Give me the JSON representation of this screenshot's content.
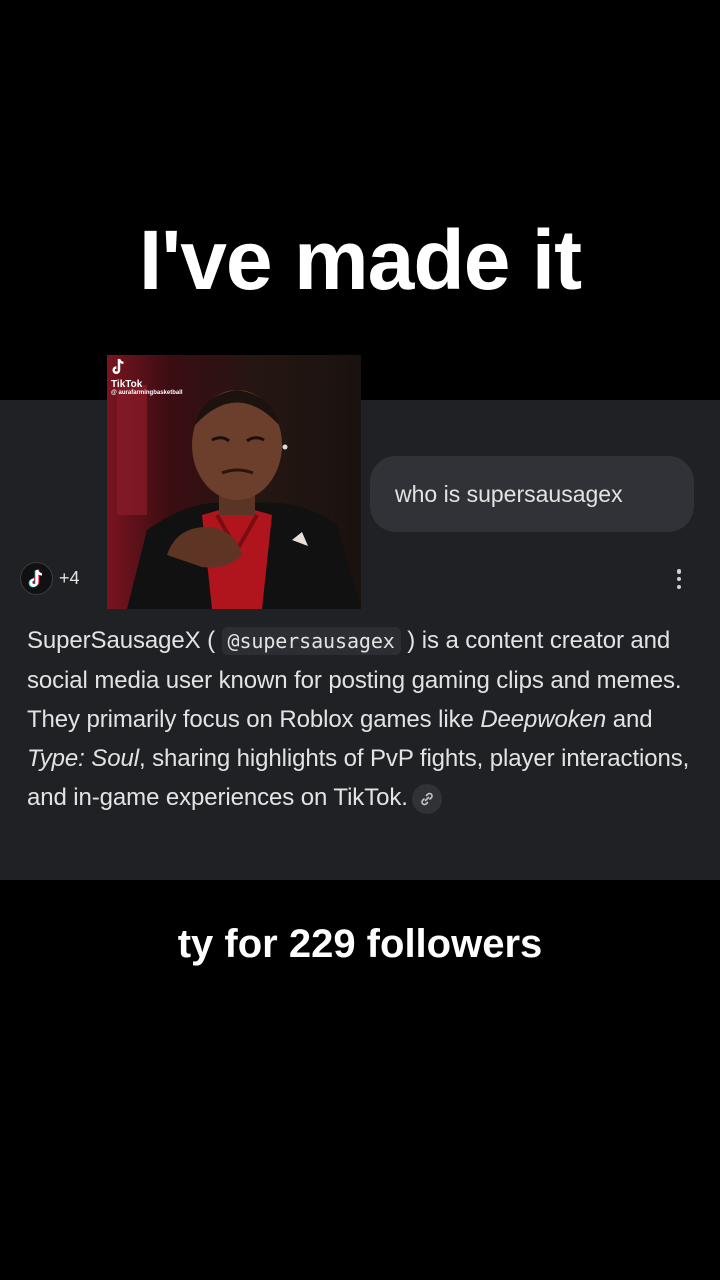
{
  "overlay": {
    "headline": "I've made it",
    "caption": "ty for 229 followers"
  },
  "chat": {
    "user_query": "who is supersausagex",
    "sources": {
      "count_label": "+4",
      "icon": "tiktok-icon"
    },
    "answer": {
      "name": "SuperSausageX",
      "open_paren": " ( ",
      "handle": "@supersausagex",
      "part1": " ) is a content creator and social media user known for posting gaming clips and memes. They primarily focus on Roblox games like ",
      "game1": "Deepwoken",
      "and": " and ",
      "game2": "Type: Soul",
      "part2": ", sharing highlights of PvP fights, player interactions, and in-game experiences on TikTok.",
      "link_icon": "link-icon"
    }
  },
  "meme": {
    "platform": "TikTok",
    "handle": "@ aurafarmingbasketball",
    "description": "man in red shirt and black jacket making a skeptical face"
  },
  "colors": {
    "background": "#000000",
    "panel": "#1f2125",
    "bubble": "#303237",
    "text": "#e3e3e3"
  }
}
